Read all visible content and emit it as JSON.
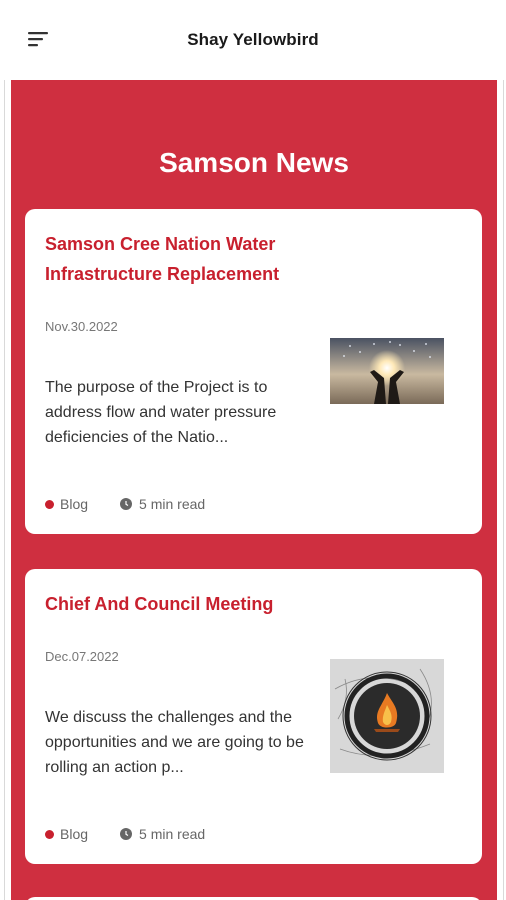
{
  "header": {
    "title": "Shay Yellowbird",
    "menu_icon": "hamburger-menu-icon"
  },
  "section": {
    "title": "Samson News"
  },
  "colors": {
    "accent": "#cf2f40",
    "title_red": "#c8202e"
  },
  "articles": [
    {
      "title": "Samson Cree Nation Water Infrastructure Replacement",
      "date": "Nov.30.2022",
      "excerpt": "The purpose of the Project is to address flow and water pressure deficiencies of the Natio...",
      "category": "Blog",
      "read_time": "5 min read",
      "image": "hands-holding-light-image"
    },
    {
      "title": "Chief And Council Meeting",
      "date": "Dec.07.2022",
      "excerpt": "We discuss the challenges and the opportunities and we are going to be rolling an action p...",
      "category": "Blog",
      "read_time": "5 min read",
      "image": "fire-circle-drawing-image"
    }
  ]
}
